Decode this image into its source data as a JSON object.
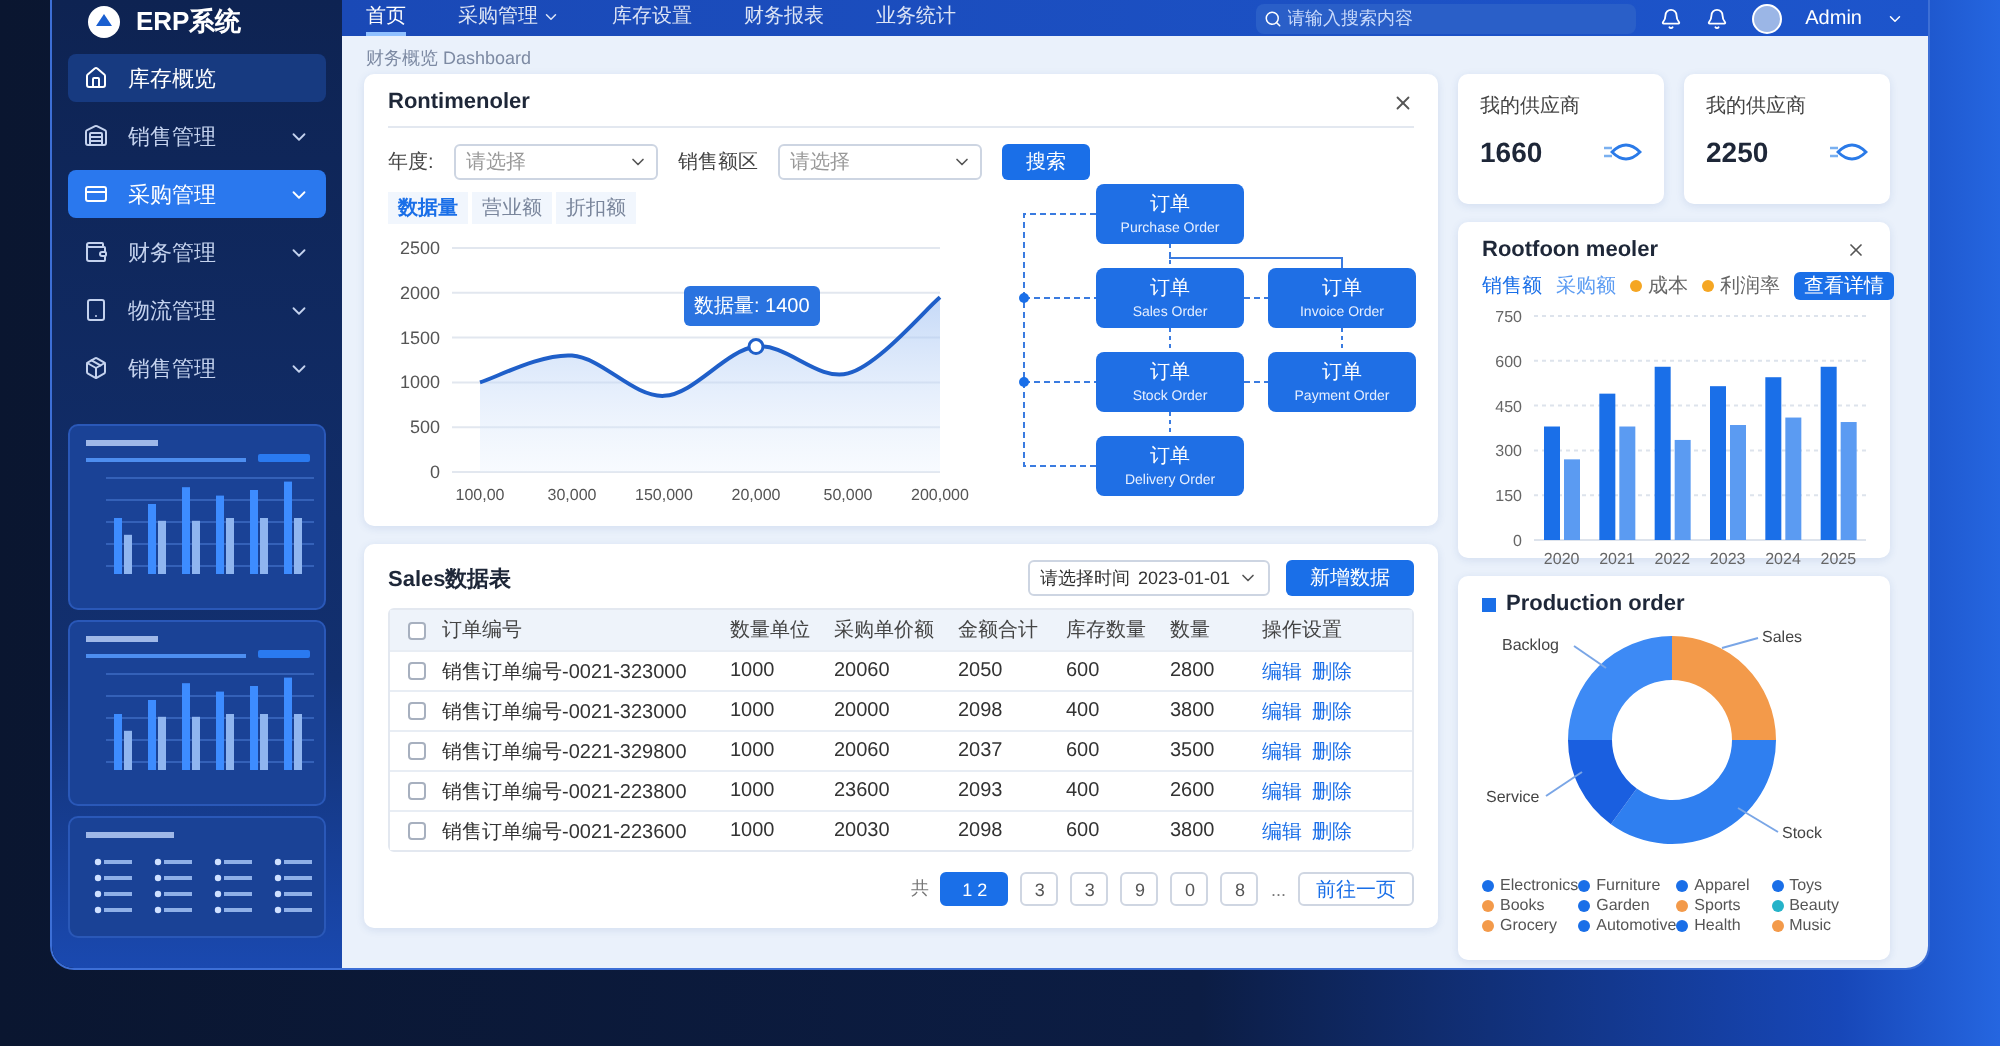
{
  "header": {
    "logo": "ERP系统",
    "nav": [
      {
        "label": "首页",
        "selected": true,
        "dropdown": false
      },
      {
        "label": "采购管理",
        "selected": false,
        "dropdown": true
      },
      {
        "label": "库存设置",
        "selected": false,
        "dropdown": false
      },
      {
        "label": "财务报表",
        "selected": false,
        "dropdown": false
      },
      {
        "label": "业务统计",
        "selected": false,
        "dropdown": false
      }
    ],
    "search": {
      "placeholder": "请输入搜索内容"
    },
    "user": {
      "name": "Admin"
    }
  },
  "sidebar": {
    "items": [
      {
        "label": "库存概览",
        "kind": "home",
        "selected": false
      },
      {
        "label": "销售管理",
        "kind": "menu",
        "selected": false
      },
      {
        "label": "采购管理",
        "kind": "menu",
        "selected": true
      },
      {
        "label": "财务管理",
        "kind": "menu",
        "selected": false
      },
      {
        "label": "物流管理",
        "kind": "menu",
        "selected": false
      },
      {
        "label": "销售管理",
        "kind": "menu",
        "selected": false
      }
    ]
  },
  "breadcrumb": "财务概览 Dashboard",
  "overview": {
    "title": "Rontimenoler",
    "filters": [
      {
        "label": "年度:",
        "placeholder": "请选择"
      },
      {
        "label": "销售额区",
        "placeholder": "请选择"
      }
    ],
    "search_button": "搜索",
    "tabs": [
      {
        "label": "数据量",
        "selected": true
      },
      {
        "label": "营业额",
        "selected": false
      },
      {
        "label": "折扣额",
        "selected": false
      }
    ],
    "chart_data": {
      "type": "area",
      "categories": [
        "100,00",
        "30,000",
        "150,000",
        "20,000",
        "50,000",
        "200,000"
      ],
      "series": [
        {
          "color": "#1f5fc9",
          "values": [
            1000,
            1300,
            850,
            1400,
            1100,
            1950
          ]
        }
      ],
      "ylim": [
        0,
        2500
      ],
      "yticks": [
        0,
        500,
        1000,
        1500,
        2000,
        2500
      ],
      "grid": true,
      "annotations": [
        "数据量: 1400"
      ]
    },
    "flow": [
      {
        "title": "订单",
        "subtitle": "Purchase Order"
      },
      {
        "title": "订单",
        "subtitle": "Sales Order"
      },
      {
        "title": "订单",
        "subtitle": "Invoice Order"
      },
      {
        "title": "订单",
        "subtitle": "Stock Order"
      },
      {
        "title": "订单",
        "subtitle": "Payment Order"
      },
      {
        "title": "订单",
        "subtitle": "Delivery Order"
      }
    ]
  },
  "stats": [
    {
      "label": "我的供应商",
      "value": "1660"
    },
    {
      "label": "我的供应商",
      "value": "2250"
    }
  ],
  "bar_card": {
    "title": "Rootfoon meoler",
    "legend": [
      {
        "label": "成本",
        "color": "#f5a623"
      },
      {
        "label": "利润率",
        "color": "#f5a623"
      }
    ],
    "button": "查看详情",
    "chart_data": {
      "type": "bar",
      "categories": [
        "2020",
        "2021",
        "2022",
        "2023",
        "2024",
        "2025"
      ],
      "series": [
        {
          "name": "销售额",
          "color": "#1a6fe8",
          "values": [
            380,
            490,
            580,
            515,
            545,
            580
          ]
        },
        {
          "name": "采购额",
          "color": "#5b9bf2",
          "values": [
            270,
            380,
            335,
            385,
            410,
            395
          ]
        }
      ],
      "ylim": [
        0,
        750
      ],
      "yticks": [
        0,
        150,
        300,
        450,
        600,
        750
      ],
      "stacked": false,
      "grid": true
    }
  },
  "table": {
    "title": "Sales数据表",
    "date_select": {
      "label": "请选择时间",
      "value": "2023-01-01"
    },
    "add_button": "新增数据",
    "all_checked": false,
    "columns": [
      "订单编号",
      "数量单位",
      "采购单价额",
      "金额合计",
      "库存数量",
      "数量",
      "操作设置"
    ],
    "rows": [
      {
        "checked": false,
        "cells": [
          "销售订单编号-0021-323000",
          "1000",
          "20060",
          "2050",
          "600",
          "2800"
        ],
        "actions": [
          "编辑",
          "删除"
        ]
      },
      {
        "checked": false,
        "cells": [
          "销售订单编号-0021-323000",
          "1000",
          "20000",
          "2098",
          "400",
          "3800"
        ],
        "actions": [
          "编辑",
          "删除"
        ]
      },
      {
        "checked": false,
        "cells": [
          "销售订单编号-0221-329800",
          "1000",
          "20060",
          "2037",
          "600",
          "3500"
        ],
        "actions": [
          "编辑",
          "删除"
        ]
      },
      {
        "checked": false,
        "cells": [
          "销售订单编号-0021-223800",
          "1000",
          "23600",
          "2093",
          "400",
          "2600"
        ],
        "actions": [
          "编辑",
          "删除"
        ]
      },
      {
        "checked": false,
        "cells": [
          "销售订单编号-0021-223600",
          "1000",
          "20030",
          "2098",
          "600",
          "3800"
        ],
        "actions": [
          "编辑",
          "删除"
        ]
      }
    ],
    "pagination": {
      "total_label": "共",
      "pages": [
        {
          "label": "1 2",
          "selected": true
        },
        {
          "label": "3",
          "selected": false
        },
        {
          "label": "3",
          "selected": false
        },
        {
          "label": "9",
          "selected": false
        },
        {
          "label": "0",
          "selected": false
        },
        {
          "label": "8",
          "selected": false
        }
      ],
      "ellipsis": "...",
      "goto": "前往一页"
    }
  },
  "donut_card": {
    "title": "Production order",
    "chart_data": {
      "type": "donut",
      "categories": [
        "Sales",
        "Stock",
        "Service",
        "Backlog"
      ],
      "values": [
        25,
        35,
        15,
        25
      ],
      "colors": [
        "#f39a4a",
        "#2f7ff0",
        "#1a5fe0",
        "#3d8af5"
      ]
    },
    "legend": [
      {
        "label": "Electronics",
        "color": "#1a6fe8"
      },
      {
        "label": "Furniture",
        "color": "#1a6fe8"
      },
      {
        "label": "Apparel",
        "color": "#1a6fe8"
      },
      {
        "label": "Toys",
        "color": "#1a6fe8"
      },
      {
        "label": "Books",
        "color": "#f39a4a"
      },
      {
        "label": "Garden",
        "color": "#1a6fe8"
      },
      {
        "label": "Sports",
        "color": "#f39a4a"
      },
      {
        "label": "Beauty",
        "color": "#26b3c9"
      },
      {
        "label": "Grocery",
        "color": "#f39a4a"
      },
      {
        "label": "Automotive",
        "color": "#1a6fe8"
      },
      {
        "label": "Health",
        "color": "#1a6fe8"
      },
      {
        "label": "Music",
        "color": "#f39a4a"
      }
    ]
  }
}
